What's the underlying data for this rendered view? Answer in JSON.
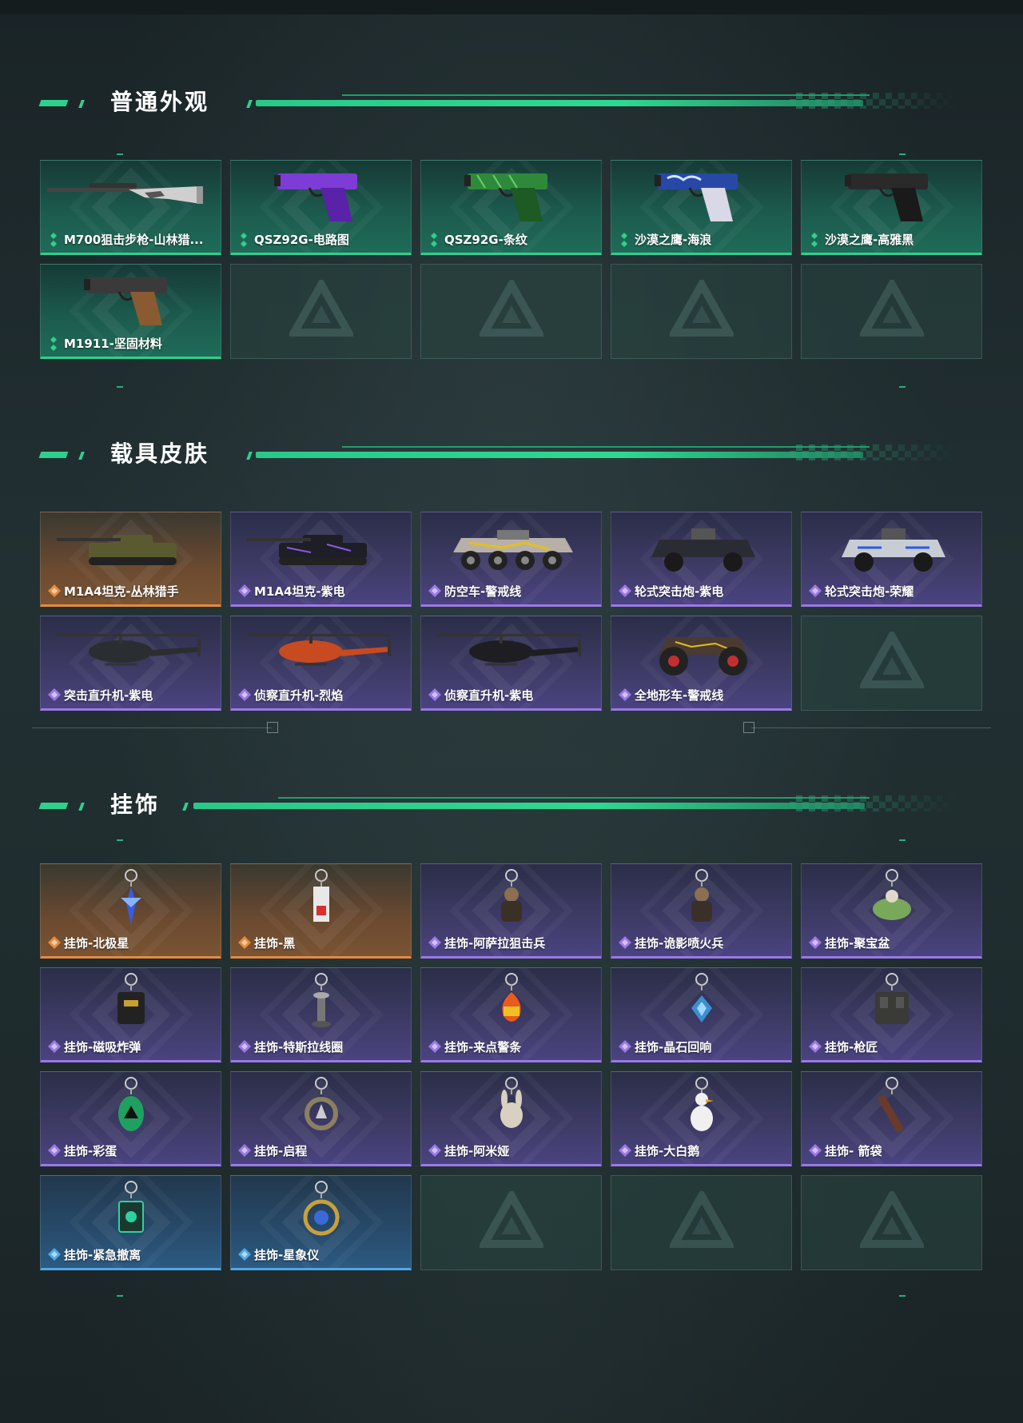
{
  "colors": {
    "accent": "#2fd08e",
    "rarity_green": "#2fd08e",
    "rarity_orange": "#e88a3a",
    "rarity_purple": "#9a78e8",
    "rarity_blue": "#4fa8e8"
  },
  "sections": [
    {
      "title": "普通外观",
      "items": [
        {
          "label": "M700狙击步枪-山林猎...",
          "rarity": "green",
          "icon": "sniper-rifle"
        },
        {
          "label": "QSZ92G-电路图",
          "rarity": "green",
          "icon": "pistol-purple"
        },
        {
          "label": "QSZ92G-条纹",
          "rarity": "green",
          "icon": "pistol-green"
        },
        {
          "label": "沙漠之鹰-海浪",
          "rarity": "green",
          "icon": "pistol-blue"
        },
        {
          "label": "沙漠之鹰-高雅黑",
          "rarity": "green",
          "icon": "pistol-black"
        },
        {
          "label": "M1911-坚固材料",
          "rarity": "green",
          "icon": "pistol-wood"
        },
        {
          "label": "",
          "rarity": "empty"
        },
        {
          "label": "",
          "rarity": "empty"
        },
        {
          "label": "",
          "rarity": "empty"
        },
        {
          "label": "",
          "rarity": "empty"
        }
      ]
    },
    {
      "title": "载具皮肤",
      "items": [
        {
          "label": "M1A4坦克-丛林猎手",
          "rarity": "orange",
          "icon": "tank-camo"
        },
        {
          "label": "M1A4坦克-紫电",
          "rarity": "purple",
          "icon": "tank-dark"
        },
        {
          "label": "防空车-警戒线",
          "rarity": "purple",
          "icon": "apc-8wheel"
        },
        {
          "label": "轮式突击炮-紫电",
          "rarity": "purple",
          "icon": "armored-car"
        },
        {
          "label": "轮式突击炮-荣耀",
          "rarity": "purple",
          "icon": "armored-car-white"
        },
        {
          "label": "突击直升机-紫电",
          "rarity": "purple",
          "icon": "helicopter-attack"
        },
        {
          "label": "侦察直升机-烈焰",
          "rarity": "purple",
          "icon": "helicopter-red"
        },
        {
          "label": "侦察直升机-紫电",
          "rarity": "purple",
          "icon": "helicopter-dark"
        },
        {
          "label": "全地形车-警戒线",
          "rarity": "purple",
          "icon": "atv"
        },
        {
          "label": "",
          "rarity": "empty"
        }
      ]
    },
    {
      "title": "挂饰",
      "items": [
        {
          "label": "挂饰-北极星",
          "rarity": "orange",
          "icon": "charm-star"
        },
        {
          "label": "挂饰-黑",
          "rarity": "orange",
          "icon": "charm-tag"
        },
        {
          "label": "挂饰-阿萨拉狙击兵",
          "rarity": "purple",
          "icon": "charm-soldier"
        },
        {
          "label": "挂饰-诡影喷火兵",
          "rarity": "purple",
          "icon": "charm-soldier"
        },
        {
          "label": "挂饰-聚宝盆",
          "rarity": "purple",
          "icon": "charm-bowl"
        },
        {
          "label": "挂饰-磁吸炸弹",
          "rarity": "purple",
          "icon": "charm-bomb"
        },
        {
          "label": "挂饰-特斯拉线圈",
          "rarity": "purple",
          "icon": "charm-coil"
        },
        {
          "label": "挂饰-来点警条",
          "rarity": "purple",
          "icon": "charm-fire"
        },
        {
          "label": "挂饰-晶石回响",
          "rarity": "purple",
          "icon": "charm-crystal"
        },
        {
          "label": "挂饰-枪匠",
          "rarity": "purple",
          "icon": "charm-vest"
        },
        {
          "label": "挂饰-彩蛋",
          "rarity": "purple",
          "icon": "charm-egg"
        },
        {
          "label": "挂饰-启程",
          "rarity": "purple",
          "icon": "charm-ring"
        },
        {
          "label": "挂饰-阿米娅",
          "rarity": "purple",
          "icon": "charm-bunny"
        },
        {
          "label": "挂饰-大白鹅",
          "rarity": "purple",
          "icon": "charm-goose"
        },
        {
          "label": "挂饰- 箭袋",
          "rarity": "purple",
          "icon": "charm-quiver"
        },
        {
          "label": "挂饰-紧急撤离",
          "rarity": "blue",
          "icon": "charm-box"
        },
        {
          "label": "挂饰-星象仪",
          "rarity": "blue",
          "icon": "charm-orb"
        },
        {
          "label": "",
          "rarity": "empty"
        },
        {
          "label": "",
          "rarity": "empty"
        },
        {
          "label": "",
          "rarity": "empty"
        }
      ]
    }
  ]
}
